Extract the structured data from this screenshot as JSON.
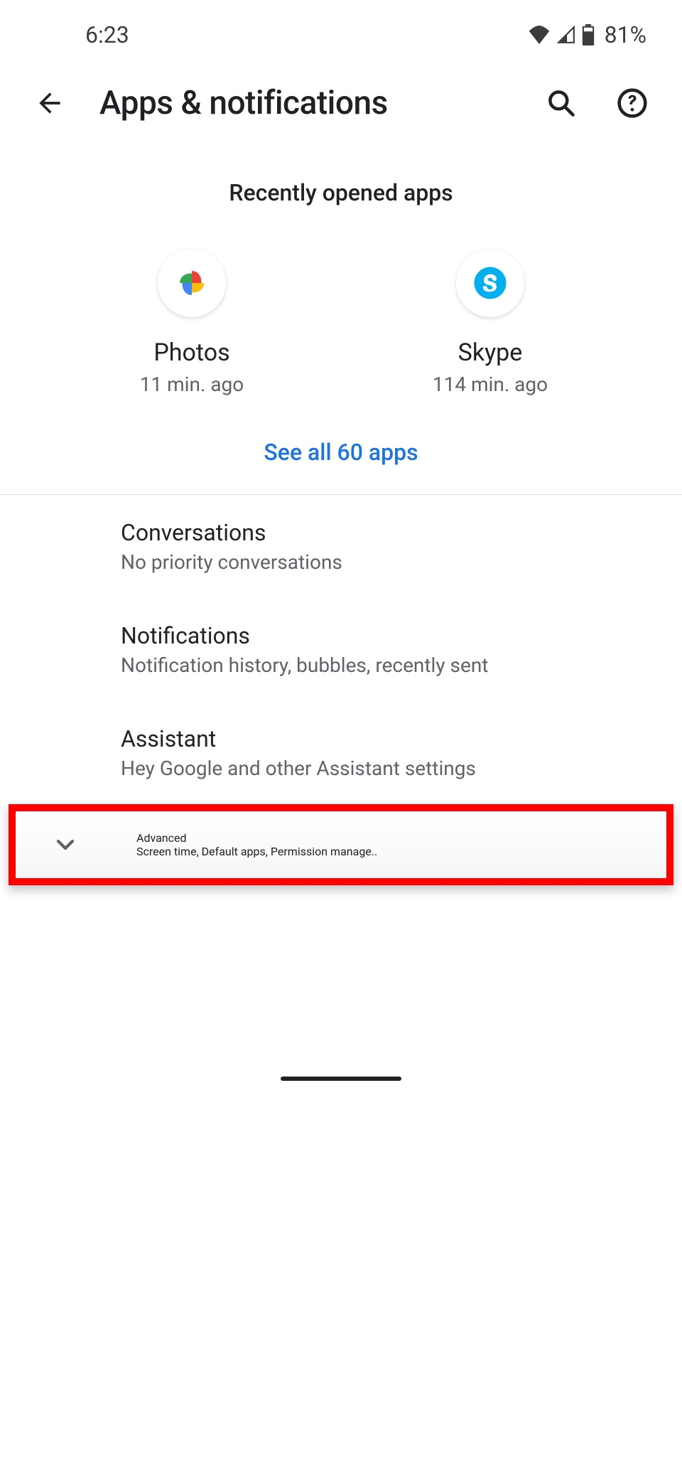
{
  "status": {
    "time": "6:23",
    "battery": "81%"
  },
  "appbar": {
    "title": "Apps & notifications"
  },
  "recent": {
    "header": "Recently opened apps",
    "apps": [
      {
        "name": "Photos",
        "sub": "11 min. ago"
      },
      {
        "name": "Skype",
        "sub": "114 min. ago"
      }
    ],
    "see_all": "See all 60 apps"
  },
  "items": [
    {
      "title": "Conversations",
      "subtitle": "No priority conversations"
    },
    {
      "title": "Notifications",
      "subtitle": "Notification history, bubbles, recently sent"
    },
    {
      "title": "Assistant",
      "subtitle": "Hey Google and other Assistant settings"
    }
  ],
  "advanced": {
    "title": "Advanced",
    "subtitle": "Screen time, Default apps, Permission manage.."
  }
}
